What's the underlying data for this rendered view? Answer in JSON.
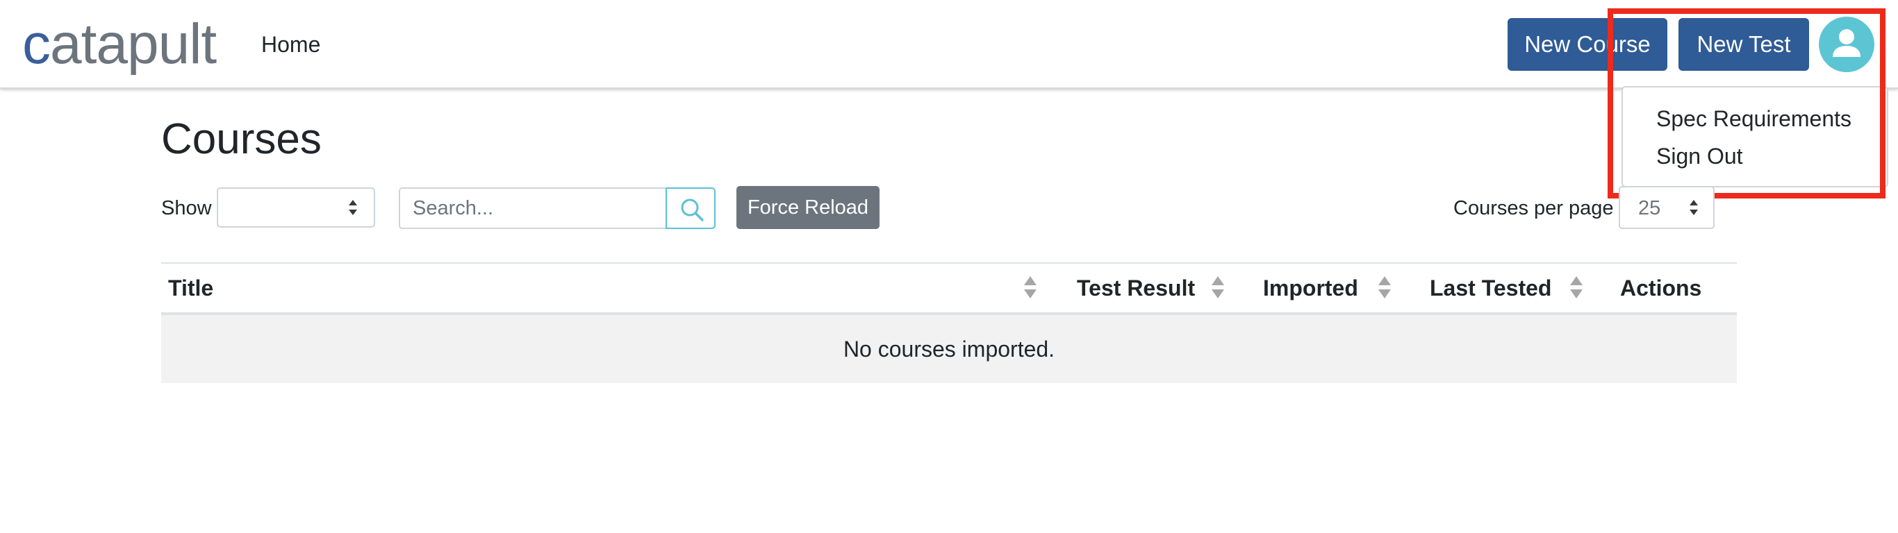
{
  "header": {
    "logo_first": "c",
    "logo_rest": "atapult",
    "nav_home": "Home",
    "new_course_label": "New Course",
    "new_test_label": "New Test",
    "avatar_icon": "user-avatar-icon"
  },
  "user_menu": {
    "items": [
      {
        "label": "Spec Requirements"
      },
      {
        "label": "Sign Out"
      }
    ]
  },
  "page": {
    "title": "Courses"
  },
  "toolbar": {
    "show_label": "Show",
    "show_value": "",
    "search_placeholder": "Search...",
    "search_icon": "search-icon",
    "force_reload_label": "Force Reload",
    "per_page_label": "Courses per page",
    "per_page_value": "25"
  },
  "table": {
    "columns": [
      "Title",
      "Test Result",
      "Imported",
      "Last Tested",
      "Actions"
    ],
    "empty_message": "No courses imported."
  },
  "colors": {
    "primary": "#2f5b96",
    "secondary": "#6c757d",
    "avatar": "#5cc5d4",
    "highlight": "#ee2a1b",
    "logo_accent": "#3a5f9a"
  }
}
